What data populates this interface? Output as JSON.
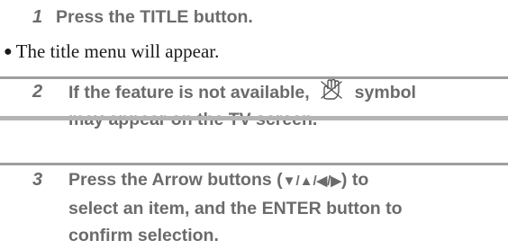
{
  "steps": [
    {
      "number": "1",
      "text": "Press the TITLE button."
    },
    {
      "number": "2",
      "lines": [
        "If the feature is not available,",
        "symbol",
        "may appear on the TV screen."
      ]
    },
    {
      "number": "3",
      "lines": [
        "Press the Arrow buttons (",
        ") to",
        "select an item, and the ENTER button to",
        "confirm selection."
      ],
      "arrows": "▼/▲/◀/▶"
    }
  ],
  "note": {
    "bullet": "●",
    "text": "The title menu will appear."
  },
  "icons": {
    "invalid_symbol": "prohibited-hand-icon"
  },
  "colors": {
    "step_text": "#6b6b6b",
    "note_text": "#1a1a1a",
    "rule": "#9e9e9e"
  }
}
